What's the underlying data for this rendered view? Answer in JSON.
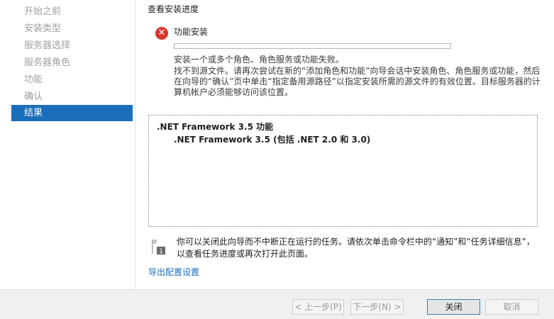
{
  "nav": {
    "items": [
      {
        "label": "开始之前"
      },
      {
        "label": "安装类型"
      },
      {
        "label": "服务器选择"
      },
      {
        "label": "服务器角色"
      },
      {
        "label": "功能"
      },
      {
        "label": "确认"
      },
      {
        "label": "结果"
      }
    ]
  },
  "main": {
    "progress_label": "查看安装进度",
    "feature_title": "功能安装",
    "error_line1": "安装一个或多个角色、角色服务或功能失败。",
    "error_line2": "找不到源文件。请再次尝试在新的“添加角色和功能”向导会话中安装角色、角色服务或功能，然后在向导的“确认”页中单击“指定备用源路径”以指定安装所需的源文件的有效位置。目标服务器的计算机帐户必须能够访问该位置。",
    "results": {
      "item1": ".NET Framework 3.5 功能",
      "item2": ".NET Framework 3.5 (包括 .NET 2.0 和 3.0)"
    },
    "info_text": "你可以关闭此向导而不中断正在运行的任务。请依次单击命令栏中的“通知”和“任务详细信息”，以查看任务进度或再次打开此页面。",
    "export_link": "导出配置设置"
  },
  "footer": {
    "prev": "< 上一步(P)",
    "next": "下一步(N) >",
    "close": "关闭",
    "cancel": "取消"
  },
  "colors": {
    "accent": "#1a6ebc",
    "error": "#d9362b"
  }
}
